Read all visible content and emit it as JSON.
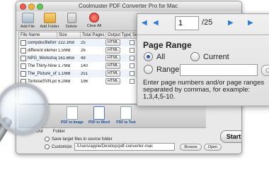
{
  "window": {
    "title": "Coolmuster PDF Converter Pro for Mac"
  },
  "toolbar": {
    "add_file": "Add File",
    "add_folder": "Add Folder",
    "delete": "Delete",
    "clear_all": "Clear All"
  },
  "table": {
    "headers": [
      "File Name",
      "Size",
      "Total Pages",
      "Output Type",
      "Selected"
    ],
    "rows": [
      {
        "name": "compdocfileforma",
        "size": "222.1KB",
        "pages": "25",
        "type": "HTML"
      },
      {
        "name": "different elements",
        "size": "1.5MB",
        "pages": "26",
        "type": "HTML"
      },
      {
        "name": "NPG_Workshop_we",
        "size": "161.6KB",
        "pages": "49",
        "type": "HTML"
      },
      {
        "name": "The Thirty-Nine St",
        "size": "1.7MB",
        "pages": "140",
        "type": "HTML"
      },
      {
        "name": "The_Picture_of_Do",
        "size": "1.1MB",
        "pages": "251",
        "type": "HTML"
      },
      {
        "name": "TortoiseSVN.pdf",
        "size": "6.2MB",
        "pages": "196",
        "type": "HTML"
      }
    ]
  },
  "formats": {
    "pdf_to_image": "PDF to Image",
    "pdf_to_word": "PDF to Word",
    "pdf_to_text": "PDF to Text"
  },
  "output": {
    "label_prefix": "Out",
    "folder_label": "Folder",
    "source_label": "Save target files in source folder",
    "customize_label": "Customize",
    "path": "/Users/apple/Desktop/pdf-converter-mac",
    "browse": "Browse",
    "open": "Open",
    "start": "Start"
  },
  "page_nav": {
    "current": "1",
    "total": "/25"
  },
  "page_range": {
    "title": "Page Range",
    "all": "All",
    "current": "Current",
    "range": "Range",
    "ok": "Ok",
    "hint": "Enter page numbers and/or page ranges separated by commas, for example: 1,3,4,5-10."
  }
}
